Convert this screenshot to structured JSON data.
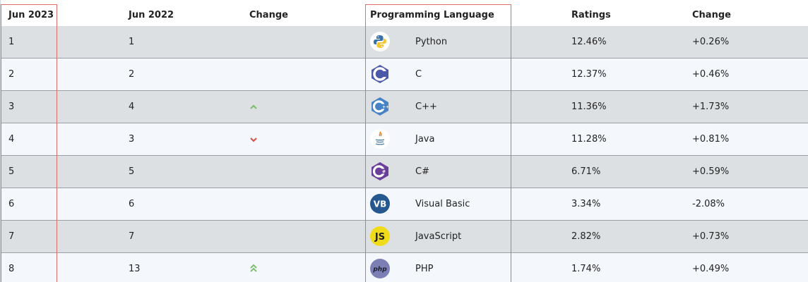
{
  "colors": {
    "row_dark": "#dde0e3",
    "row_light": "#f4f8fc",
    "highlight": "#e06b6b",
    "trend_up": "#7cbf6e",
    "trend_down": "#d9534f"
  },
  "header": {
    "jun2023": "Jun 2023",
    "jun2022": "Jun 2022",
    "change": "Change",
    "language": "Programming Language",
    "ratings": "Ratings",
    "change_pct": "Change"
  },
  "rows": [
    {
      "jun2023": "1",
      "jun2022": "1",
      "trend": "none",
      "icon": "python-logo-icon",
      "name": "Python",
      "rating": "12.46%",
      "delta": "+0.26%"
    },
    {
      "jun2023": "2",
      "jun2022": "2",
      "trend": "none",
      "icon": "c-logo-icon",
      "name": "C",
      "rating": "12.37%",
      "delta": "+0.46%"
    },
    {
      "jun2023": "3",
      "jun2022": "4",
      "trend": "up",
      "icon": "cpp-logo-icon",
      "name": "C++",
      "rating": "11.36%",
      "delta": "+1.73%"
    },
    {
      "jun2023": "4",
      "jun2022": "3",
      "trend": "down",
      "icon": "java-logo-icon",
      "name": "Java",
      "rating": "11.28%",
      "delta": "+0.81%"
    },
    {
      "jun2023": "5",
      "jun2022": "5",
      "trend": "none",
      "icon": "csharp-logo-icon",
      "name": "C#",
      "rating": "6.71%",
      "delta": "+0.59%"
    },
    {
      "jun2023": "6",
      "jun2022": "6",
      "trend": "none",
      "icon": "visual-basic-logo-icon",
      "name": "Visual Basic",
      "rating": "3.34%",
      "delta": "-2.08%"
    },
    {
      "jun2023": "7",
      "jun2022": "7",
      "trend": "none",
      "icon": "javascript-logo-icon",
      "name": "JavaScript",
      "rating": "2.82%",
      "delta": "+0.73%"
    },
    {
      "jun2023": "8",
      "jun2022": "13",
      "trend": "double-up",
      "icon": "php-logo-icon",
      "name": "PHP",
      "rating": "1.74%",
      "delta": "+0.49%"
    }
  ]
}
